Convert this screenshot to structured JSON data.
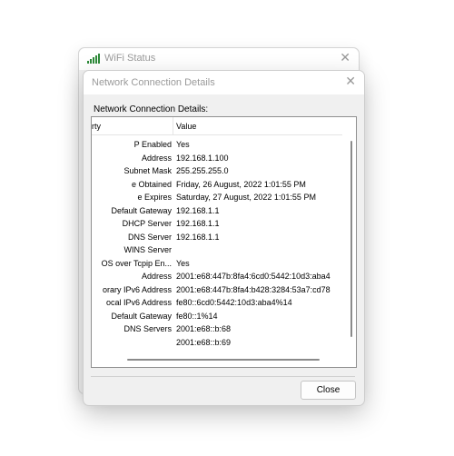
{
  "back_window": {
    "title": "WiFi Status",
    "close_glyph": "✕",
    "icon": "wifi-signal-icon"
  },
  "dialog": {
    "title": "Network Connection Details",
    "close_glyph": "✕",
    "section_label": "Network Connection Details:",
    "columns": {
      "property": "rty",
      "value": "Value"
    },
    "rows": [
      {
        "property": "P Enabled",
        "value": "Yes"
      },
      {
        "property": "Address",
        "value": "192.168.1.100"
      },
      {
        "property": "Subnet Mask",
        "value": "255.255.255.0"
      },
      {
        "property": "e Obtained",
        "value": "Friday, 26 August, 2022 1:01:55 PM"
      },
      {
        "property": "e Expires",
        "value": "Saturday, 27 August, 2022 1:01:55 PM"
      },
      {
        "property": "Default Gateway",
        "value": "192.168.1.1"
      },
      {
        "property": "DHCP Server",
        "value": "192.168.1.1"
      },
      {
        "property": "DNS Server",
        "value": "192.168.1.1"
      },
      {
        "property": "WINS Server",
        "value": ""
      },
      {
        "property": "OS over Tcpip En...",
        "value": "Yes"
      },
      {
        "property": "Address",
        "value": "2001:e68:447b:8fa4:6cd0:5442:10d3:aba4"
      },
      {
        "property": "orary IPv6 Address",
        "value": "2001:e68:447b:8fa4:b428:3284:53a7:cd78"
      },
      {
        "property": "ocal IPv6 Address",
        "value": "fe80::6cd0:5442:10d3:aba4%14"
      },
      {
        "property": "Default Gateway",
        "value": "fe80::1%14"
      },
      {
        "property": "DNS Servers",
        "value": "2001:e68::b:68"
      },
      {
        "property": "",
        "value": "2001:e68::b:69"
      }
    ],
    "close_button": "Close"
  },
  "colors": {
    "accent_wifi": "#2e8b3a",
    "title_text": "#9a9a9a"
  }
}
